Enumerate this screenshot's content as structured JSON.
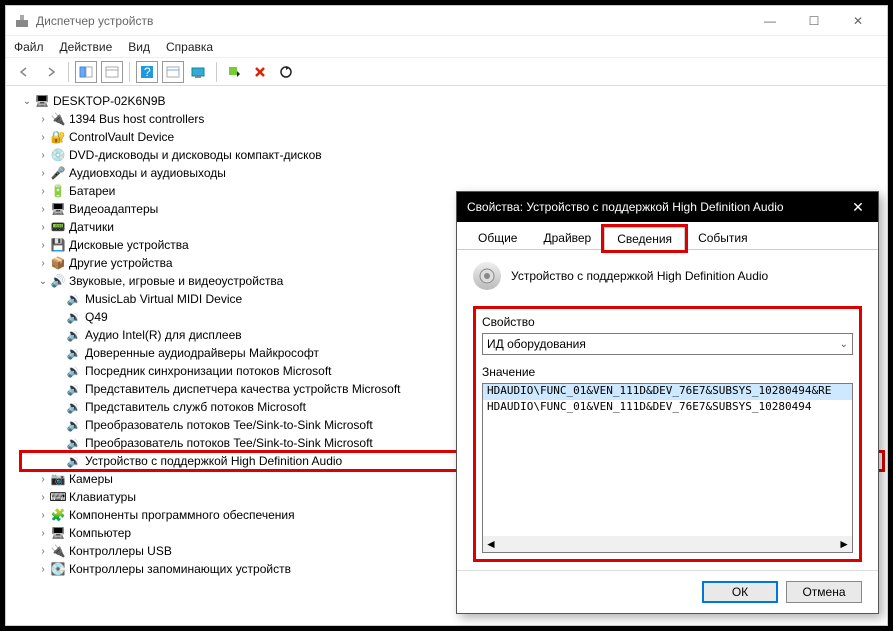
{
  "window": {
    "title": "Диспетчер устройств"
  },
  "menu": {
    "file": "Файл",
    "action": "Действие",
    "view": "Вид",
    "help": "Справка"
  },
  "tree": {
    "root": "DESKTOP-02K6N9B",
    "n1": "1394 Bus host controllers",
    "n2": "ControlVault Device",
    "n3": "DVD-дисководы и дисководы компакт-дисков",
    "n4": "Аудиовходы и аудиовыходы",
    "n5": "Батареи",
    "n6": "Видеоадаптеры",
    "n7": "Датчики",
    "n8": "Дисковые устройства",
    "n9": "Другие устройства",
    "n10": "Звуковые, игровые и видеоустройства",
    "n10a": "MusicLab Virtual MIDI Device",
    "n10b": "Q49",
    "n10c": "Аудио Intel(R) для дисплеев",
    "n10d": "Доверенные аудиодрайверы Майкрософт",
    "n10e": "Посредник синхронизации потоков Microsoft",
    "n10f": "Представитель диспетчера качества устройств Microsoft",
    "n10g": "Представитель служб потоков Microsoft",
    "n10h": "Преобразователь потоков Tee/Sink-to-Sink Microsoft",
    "n10i": "Преобразователь потоков Tee/Sink-to-Sink Microsoft",
    "n10j": "Устройство с поддержкой High Definition Audio",
    "n11": "Камеры",
    "n12": "Клавиатуры",
    "n13": "Компоненты программного обеспечения",
    "n14": "Компьютер",
    "n15": "Контроллеры USB",
    "n16": "Контроллеры запоминающих устройств"
  },
  "dialog": {
    "title": "Свойства: Устройство с поддержкой High Definition Audio",
    "tabs": {
      "general": "Общие",
      "driver": "Драйвер",
      "details": "Сведения",
      "events": "События"
    },
    "device_name": "Устройство с поддержкой High Definition Audio",
    "property_label": "Свойство",
    "property_value": "ИД оборудования",
    "value_label": "Значение",
    "values": [
      "HDAUDIO\\FUNC_01&VEN_111D&DEV_76E7&SUBSYS_10280494&RE",
      "HDAUDIO\\FUNC_01&VEN_111D&DEV_76E7&SUBSYS_10280494"
    ],
    "ok": "ОК",
    "cancel": "Отмена"
  }
}
